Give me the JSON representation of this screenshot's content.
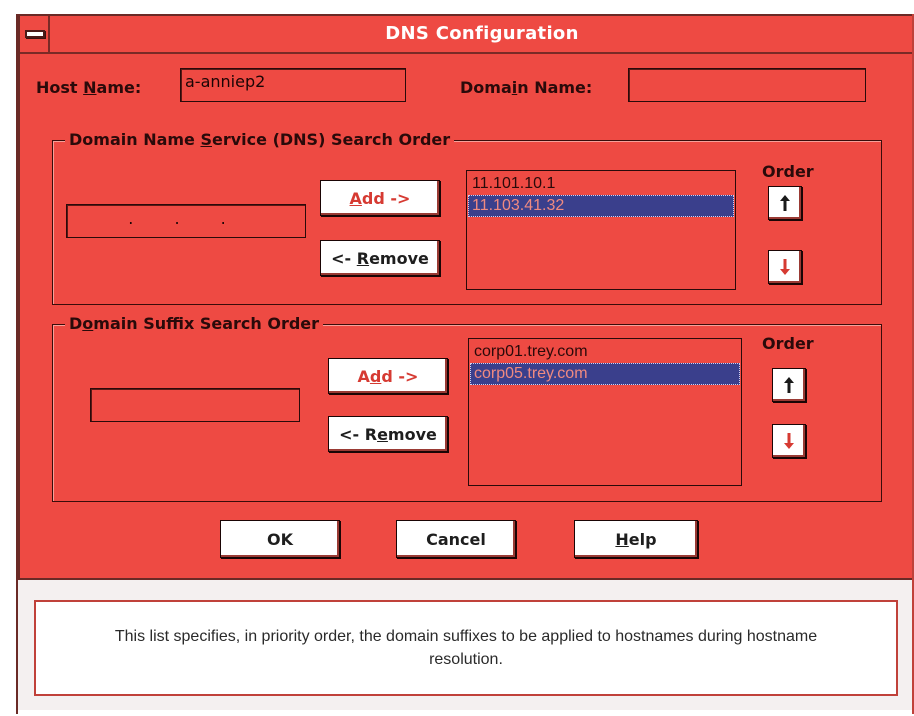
{
  "window": {
    "title": "DNS Configuration",
    "accent_color": "#ee4a43",
    "selection_color": "#3a3f8c"
  },
  "host": {
    "label": "Host Name:",
    "value": "a-anniep2"
  },
  "domain": {
    "label": "Domain Name:",
    "value": ""
  },
  "dns_group": {
    "title": "Domain Name Service (DNS) Search Order",
    "input_value": ". . .",
    "add_label": "Add ->",
    "remove_label": "<- Remove",
    "order_label": "Order",
    "items": [
      {
        "text": "11.101.10.1",
        "selected": false
      },
      {
        "text": "11.103.41.32",
        "selected": true
      }
    ],
    "up_icon": "arrow-up-icon",
    "down_icon": "arrow-down-icon"
  },
  "suffix_group": {
    "title": "Domain Suffix Search Order",
    "input_value": "",
    "add_label": "Add ->",
    "remove_label": "<- Remove",
    "order_label": "Order",
    "items": [
      {
        "text": "corp01.trey.com",
        "selected": false
      },
      {
        "text": "corp05.trey.com",
        "selected": true
      }
    ],
    "up_icon": "arrow-up-icon",
    "down_icon": "arrow-down-icon"
  },
  "buttons": {
    "ok": "OK",
    "cancel": "Cancel",
    "help": "Help"
  },
  "status": {
    "text": "This list specifies, in priority order, the domain suffixes to be applied to hostnames during hostname resolution."
  }
}
